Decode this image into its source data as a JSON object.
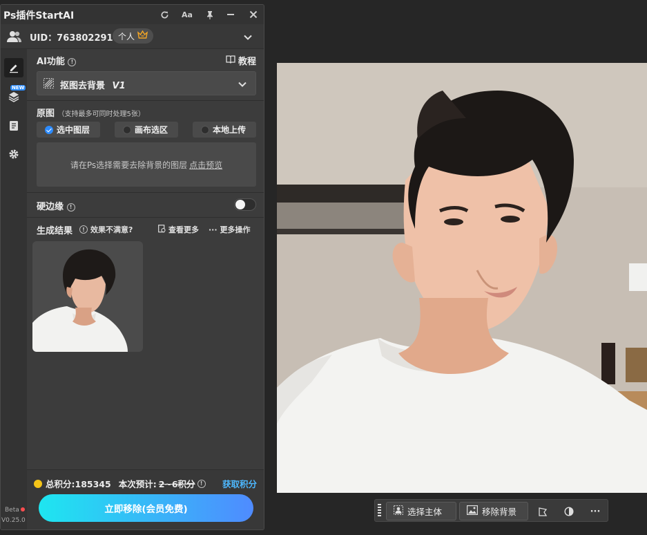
{
  "app": {
    "title": "Ps插件StartAI"
  },
  "account": {
    "uid_text": "UID：763802291",
    "plan": "个人"
  },
  "ai_function": {
    "label": "AI功能",
    "tutorial_label": "教程",
    "selected_function": "抠图去背景",
    "version_tag": "V1"
  },
  "source": {
    "label": "原图",
    "hint": "（支持最多可同时处理5张）",
    "options": [
      {
        "label": "选中图层",
        "selected": true
      },
      {
        "label": "画布选区",
        "selected": false
      },
      {
        "label": "本地上传",
        "selected": false
      }
    ],
    "dropzone_text": "请在Ps选择需要去除背景的图层",
    "dropzone_link": "点击预览"
  },
  "hard_edge": {
    "label": "硬边缘",
    "enabled": false
  },
  "results": {
    "label": "生成结果",
    "feedback": "效果不满意?",
    "view_more": "查看更多",
    "more_actions": "更多操作"
  },
  "footer": {
    "total_credits": "总积分:185345",
    "estimate_prefix": "本次预计:",
    "estimate_value": "2~6积分",
    "get_credits": "获取积分",
    "primary_button": "立即移除(会员免费)"
  },
  "sidebar": {
    "new_badge": "NEW",
    "beta": "Beta",
    "version": "V0.25.0"
  },
  "context_toolbar": {
    "select_subject": "选择主体",
    "remove_background": "移除背景"
  },
  "colors": {
    "accent_blue": "#2d8cff",
    "link_blue": "#4db8ff",
    "gradient_start": "#1ee6f0",
    "gradient_end": "#4f8bff",
    "coin": "#f5c518"
  }
}
